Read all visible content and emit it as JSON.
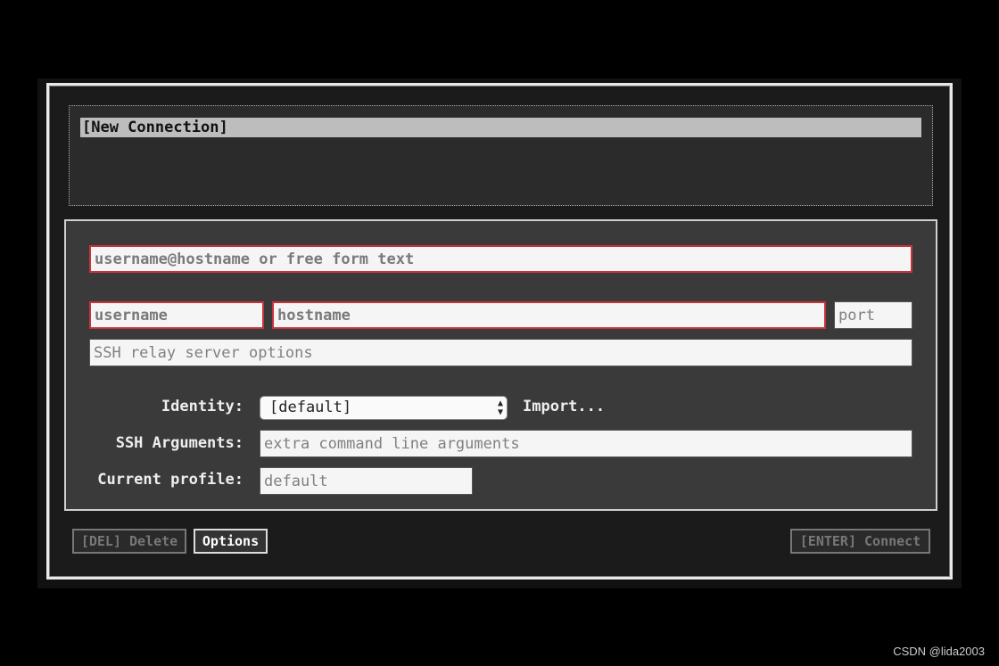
{
  "connections": {
    "items": [
      {
        "label": "[New Connection]",
        "selected": true
      }
    ]
  },
  "form": {
    "destination_placeholder": "username@hostname or free form text",
    "username_placeholder": "username",
    "hostname_placeholder": "hostname",
    "port_placeholder": "port",
    "relay_placeholder": "SSH relay server options",
    "identity_label": "Identity:",
    "identity_value": "[default]",
    "import_label": "Import...",
    "ssh_args_label": "SSH Arguments:",
    "ssh_args_placeholder": "extra command line arguments",
    "profile_label": "Current profile:",
    "profile_value": "default"
  },
  "buttons": {
    "delete": "[DEL] Delete",
    "options": "Options",
    "connect": "[ENTER] Connect"
  },
  "watermark": "CSDN @lida2003",
  "colors": {
    "error_border": "#c8323c",
    "selection": "#bdbdbd"
  }
}
